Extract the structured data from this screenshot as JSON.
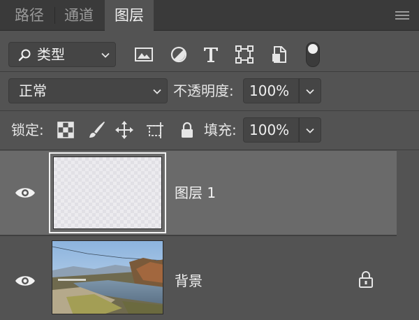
{
  "tabs": [
    {
      "label": "路径",
      "active": false
    },
    {
      "label": "通道",
      "active": false
    },
    {
      "label": "图层",
      "active": true
    }
  ],
  "filter": {
    "kind_label": "类型",
    "icons": [
      "image-filter-icon",
      "adjustment-filter-icon",
      "text-filter-icon",
      "shape-filter-icon",
      "smart-object-filter-icon"
    ],
    "toggle_on": true
  },
  "blend": {
    "mode": "正常",
    "opacity_label": "不透明度:",
    "opacity_value": "100%"
  },
  "lock": {
    "label": "锁定:",
    "icons": [
      "lock-transparent-pixels-icon",
      "lock-image-pixels-icon",
      "lock-position-icon",
      "lock-artboard-icon",
      "lock-all-icon"
    ],
    "fill_label": "填充:",
    "fill_value": "100%"
  },
  "layers": [
    {
      "name": "图层 1",
      "visible": true,
      "selected": true,
      "locked": false,
      "thumbnail": "transparent"
    },
    {
      "name": "背景",
      "visible": true,
      "selected": false,
      "locked": true,
      "thumbnail": "landscape-photo"
    }
  ],
  "colors": {
    "panel_bg": "#535353",
    "tabbar_bg": "#3a3a3a",
    "selected_layer_bg": "#6a6a6a",
    "text": "#e6e6e6"
  }
}
